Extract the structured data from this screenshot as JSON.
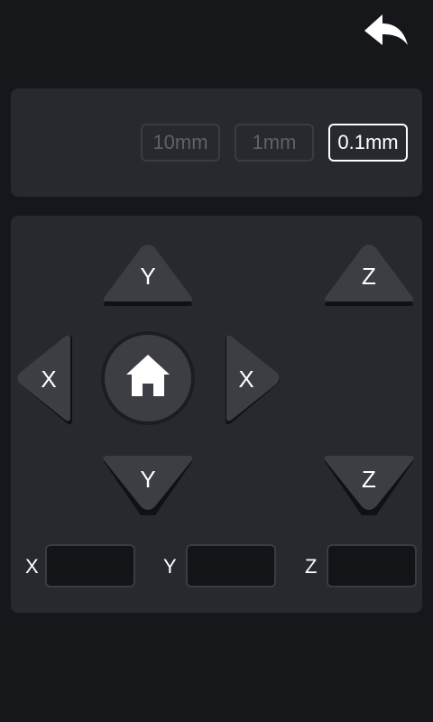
{
  "header": {
    "back_icon": "undo-arrow-icon"
  },
  "step_selector": {
    "options": [
      "10mm",
      "1mm",
      "0.1mm"
    ],
    "selected": "0.1mm"
  },
  "jog": {
    "y_up_label": "Y",
    "y_down_label": "Y",
    "x_left_label": "X",
    "x_right_label": "X",
    "z_up_label": "Z",
    "z_down_label": "Z",
    "home_icon": "home-icon"
  },
  "coordinates": {
    "x_label": "X",
    "y_label": "Y",
    "z_label": "Z",
    "x_value": "",
    "y_value": "",
    "z_value": ""
  },
  "colors": {
    "background": "#16171b",
    "panel": "#27292e",
    "button": "#3c3e44",
    "active_border": "#ffffff",
    "inactive_text": "#5e6167"
  }
}
